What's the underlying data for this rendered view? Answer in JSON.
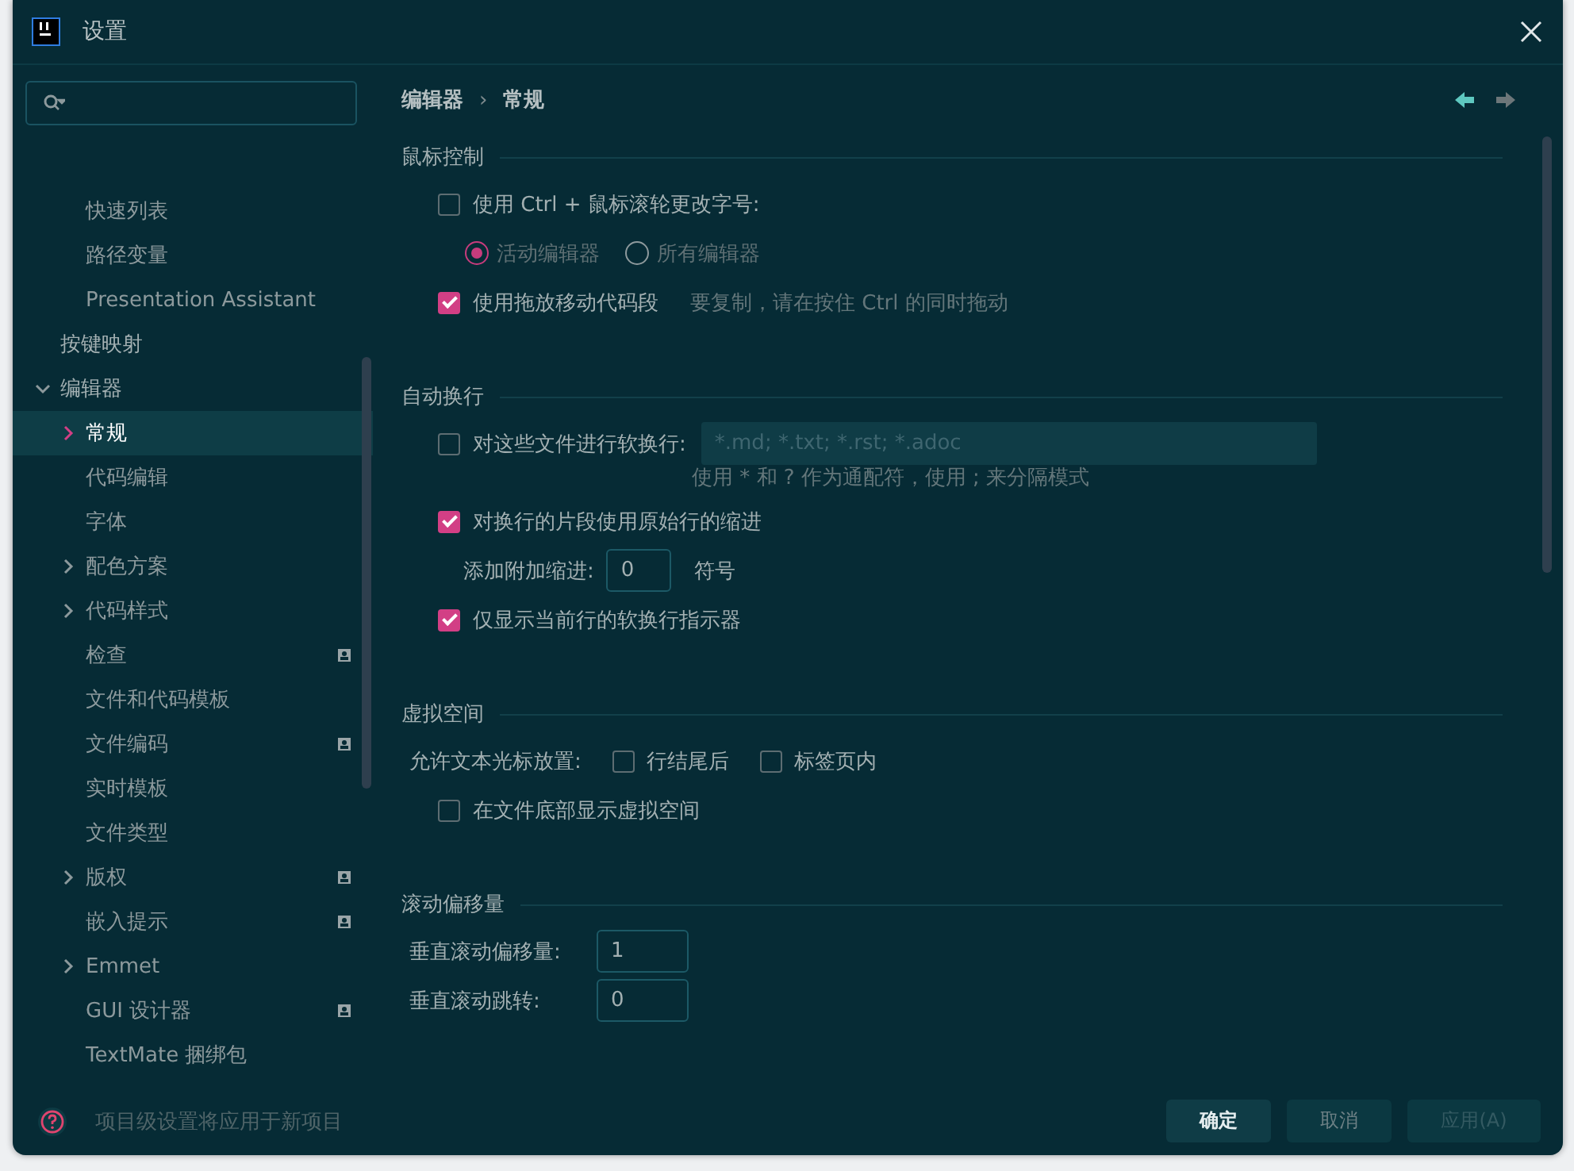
{
  "window": {
    "title": "设置"
  },
  "sidebar": {
    "partial_group": [
      {
        "label": "快速列表",
        "selected": false
      },
      {
        "label": "路径变量",
        "selected": false
      },
      {
        "label": "Presentation Assistant",
        "selected": false
      }
    ],
    "items": [
      {
        "label": "按键映射",
        "selected": false
      },
      {
        "label": "编辑器",
        "selected": false,
        "expanded": true,
        "children": [
          {
            "label": "常规",
            "selected": true,
            "expandable": true,
            "project": false
          },
          {
            "label": "代码编辑",
            "selected": false,
            "expandable": false,
            "project": false
          },
          {
            "label": "字体",
            "selected": false,
            "expandable": false,
            "project": false
          },
          {
            "label": "配色方案",
            "selected": false,
            "expandable": true,
            "project": false
          },
          {
            "label": "代码样式",
            "selected": false,
            "expandable": true,
            "project": false
          },
          {
            "label": "检查",
            "selected": false,
            "expandable": false,
            "project": true
          },
          {
            "label": "文件和代码模板",
            "selected": false,
            "expandable": false,
            "project": false
          },
          {
            "label": "文件编码",
            "selected": false,
            "expandable": false,
            "project": true
          },
          {
            "label": "实时模板",
            "selected": false,
            "expandable": false,
            "project": false
          },
          {
            "label": "文件类型",
            "selected": false,
            "expandable": false,
            "project": false
          },
          {
            "label": "版权",
            "selected": false,
            "expandable": true,
            "project": true
          },
          {
            "label": "嵌入提示",
            "selected": false,
            "expandable": false,
            "project": true
          },
          {
            "label": "Emmet",
            "selected": false,
            "expandable": true,
            "project": false
          },
          {
            "label": "GUI 设计器",
            "selected": false,
            "expandable": false,
            "project": true
          },
          {
            "label": "TextMate 捆绑包",
            "selected": false,
            "expandable": false,
            "project": false
          }
        ]
      }
    ]
  },
  "breadcrumb": [
    "编辑器",
    "›",
    "常规"
  ],
  "history": {
    "back_disabled": false,
    "forward_disabled": true
  },
  "sections": [
    {
      "title": "鼠标控制",
      "rows": [
        {
          "kind": "checkbox",
          "label": "使用 Ctrl + 鼠标滚轮更改字号:",
          "checked": false
        },
        {
          "kind": "radios",
          "disabled": true,
          "options": [
            {
              "label": "活动编辑器",
              "selected": true
            },
            {
              "label": "所有编辑器",
              "selected": false
            }
          ]
        },
        {
          "kind": "checkbox",
          "label": "使用拖放移动代码段",
          "checked": true,
          "hint": "要复制，请在按住 Ctrl 的同时拖动"
        }
      ]
    },
    {
      "title": "自动换行",
      "rows": [
        {
          "kind": "checkbox_field",
          "label": "对这些文件进行软换行:",
          "checked": false,
          "placeholder": "*.md; *.txt; *.rst; *.adoc"
        },
        {
          "kind": "note",
          "text": "使用 * 和 ? 作为通配符，使用 ; 来分隔模式"
        },
        {
          "kind": "checkbox",
          "label": "对换行的片段使用原始行的缩进",
          "checked": true
        },
        {
          "kind": "nested_number",
          "label": "添加附加缩进:",
          "value": "0",
          "unit": "符号"
        },
        {
          "kind": "checkbox",
          "label": "仅显示当前行的软换行指示器",
          "checked": true
        }
      ]
    },
    {
      "title": "虚拟空间",
      "rows": [
        {
          "kind": "choices",
          "label": "允许文本光标放置:",
          "options": [
            {
              "label": "行结尾后",
              "checked": false
            },
            {
              "label": "标签页内",
              "checked": false
            }
          ]
        },
        {
          "kind": "checkbox",
          "label": "在文件底部显示虚拟空间",
          "checked": false
        }
      ]
    },
    {
      "title": "滚动偏移量",
      "rows": [
        {
          "kind": "number",
          "label": "垂直滚动偏移量:",
          "value": "1"
        },
        {
          "kind": "number",
          "label": "垂直滚动跳转:",
          "value": "0"
        }
      ]
    }
  ],
  "footer": {
    "note": "项目级设置将应用于新项目",
    "buttons": [
      {
        "label": "确定",
        "kind": "default",
        "disabled": false
      },
      {
        "label": "取消",
        "kind": "normal",
        "disabled": false
      },
      {
        "label": "应用(A)",
        "kind": "normal",
        "disabled": true
      }
    ]
  }
}
